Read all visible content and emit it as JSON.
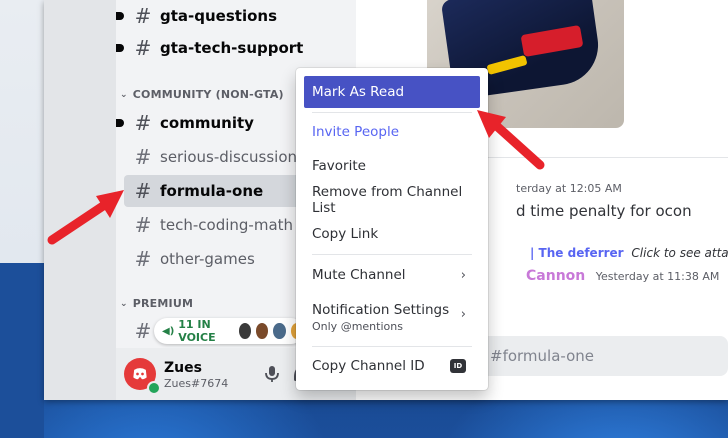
{
  "channels": {
    "items": [
      {
        "name": "gta-questions",
        "state": "unread"
      },
      {
        "name": "gta-tech-support",
        "state": "unread"
      },
      {
        "name": "community",
        "state": "unread"
      },
      {
        "name": "serious-discussions",
        "state": "muted"
      },
      {
        "name": "formula-one",
        "state": "selected"
      },
      {
        "name": "tech-coding-math",
        "state": "muted"
      },
      {
        "name": "other-games",
        "state": "muted"
      }
    ],
    "categories": [
      "COMMUNITY (NON-GTA)",
      "PREMIUM"
    ],
    "hash_glyph": "#",
    "voice_label": "11 IN VOICE"
  },
  "user": {
    "name": "Zues",
    "tag": "Zues#7674",
    "status_color": "#23a55a",
    "avatar_color": "#e53a3a"
  },
  "chat": {
    "msg1_ts": "terday at 12:05 AM",
    "msg1_text": "d time penalty for ocon",
    "reply_name": "| The deferrer",
    "reply_text": "Click to see attachment",
    "msg2_author": "Cannon",
    "msg2_ts": "Yesterday at 11:38 AM",
    "input_placeholder": "#formula-one"
  },
  "context_menu": {
    "mark_as_read": "Mark As Read",
    "invite_people": "Invite People",
    "favorite": "Favorite",
    "remove_from_list": "Remove from Channel List",
    "copy_link": "Copy Link",
    "mute_channel": "Mute Channel",
    "notification_settings": "Notification Settings",
    "notification_sub": "Only @mentions",
    "copy_channel_id": "Copy Channel ID",
    "id_badge": "ID"
  },
  "colors": {
    "accent": "#4752c4",
    "annotation_arrow": "#e8232a",
    "link": "#5865f2"
  }
}
